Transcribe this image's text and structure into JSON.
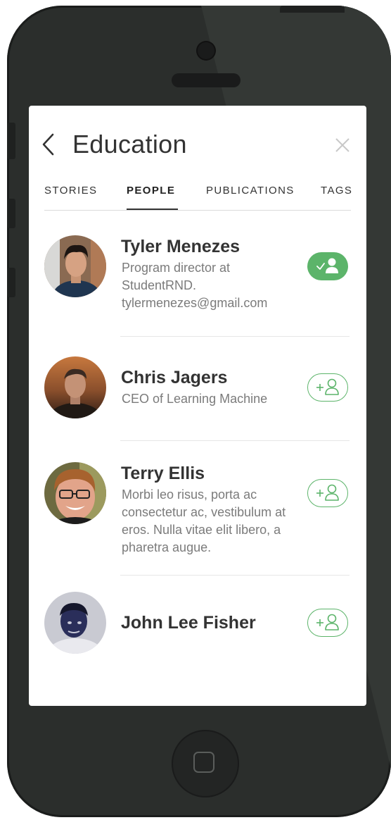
{
  "header": {
    "title": "Education",
    "back_icon": "chevron-left-icon",
    "close_icon": "close-icon"
  },
  "tabs": [
    {
      "label": "STORIES",
      "active": false
    },
    {
      "label": "PEOPLE",
      "active": true
    },
    {
      "label": "PUBLICATIONS",
      "active": false
    },
    {
      "label": "TAGS",
      "active": false
    }
  ],
  "people": [
    {
      "name": "Tyler Menezes",
      "bio": "Program director at StudentRND. tylermenezes@gmail.com",
      "following": true,
      "follow_icon": "user-check-icon"
    },
    {
      "name": "Chris Jagers",
      "bio": "CEO of Learning Machine",
      "following": false,
      "follow_icon": "user-add-icon"
    },
    {
      "name": "Terry Ellis",
      "bio": "Morbi leo risus, porta ac consectetur ac, vestibulum at eros. Nulla vitae elit libero, a pharetra augue.",
      "following": false,
      "follow_icon": "user-add-icon"
    },
    {
      "name": "John Lee Fisher",
      "bio": "",
      "following": false,
      "follow_icon": "user-add-icon"
    }
  ],
  "colors": {
    "accent": "#5cb46a",
    "phone_body": "#2b2e2c",
    "text": "#333333",
    "secondary_text": "#7b7b7b"
  }
}
